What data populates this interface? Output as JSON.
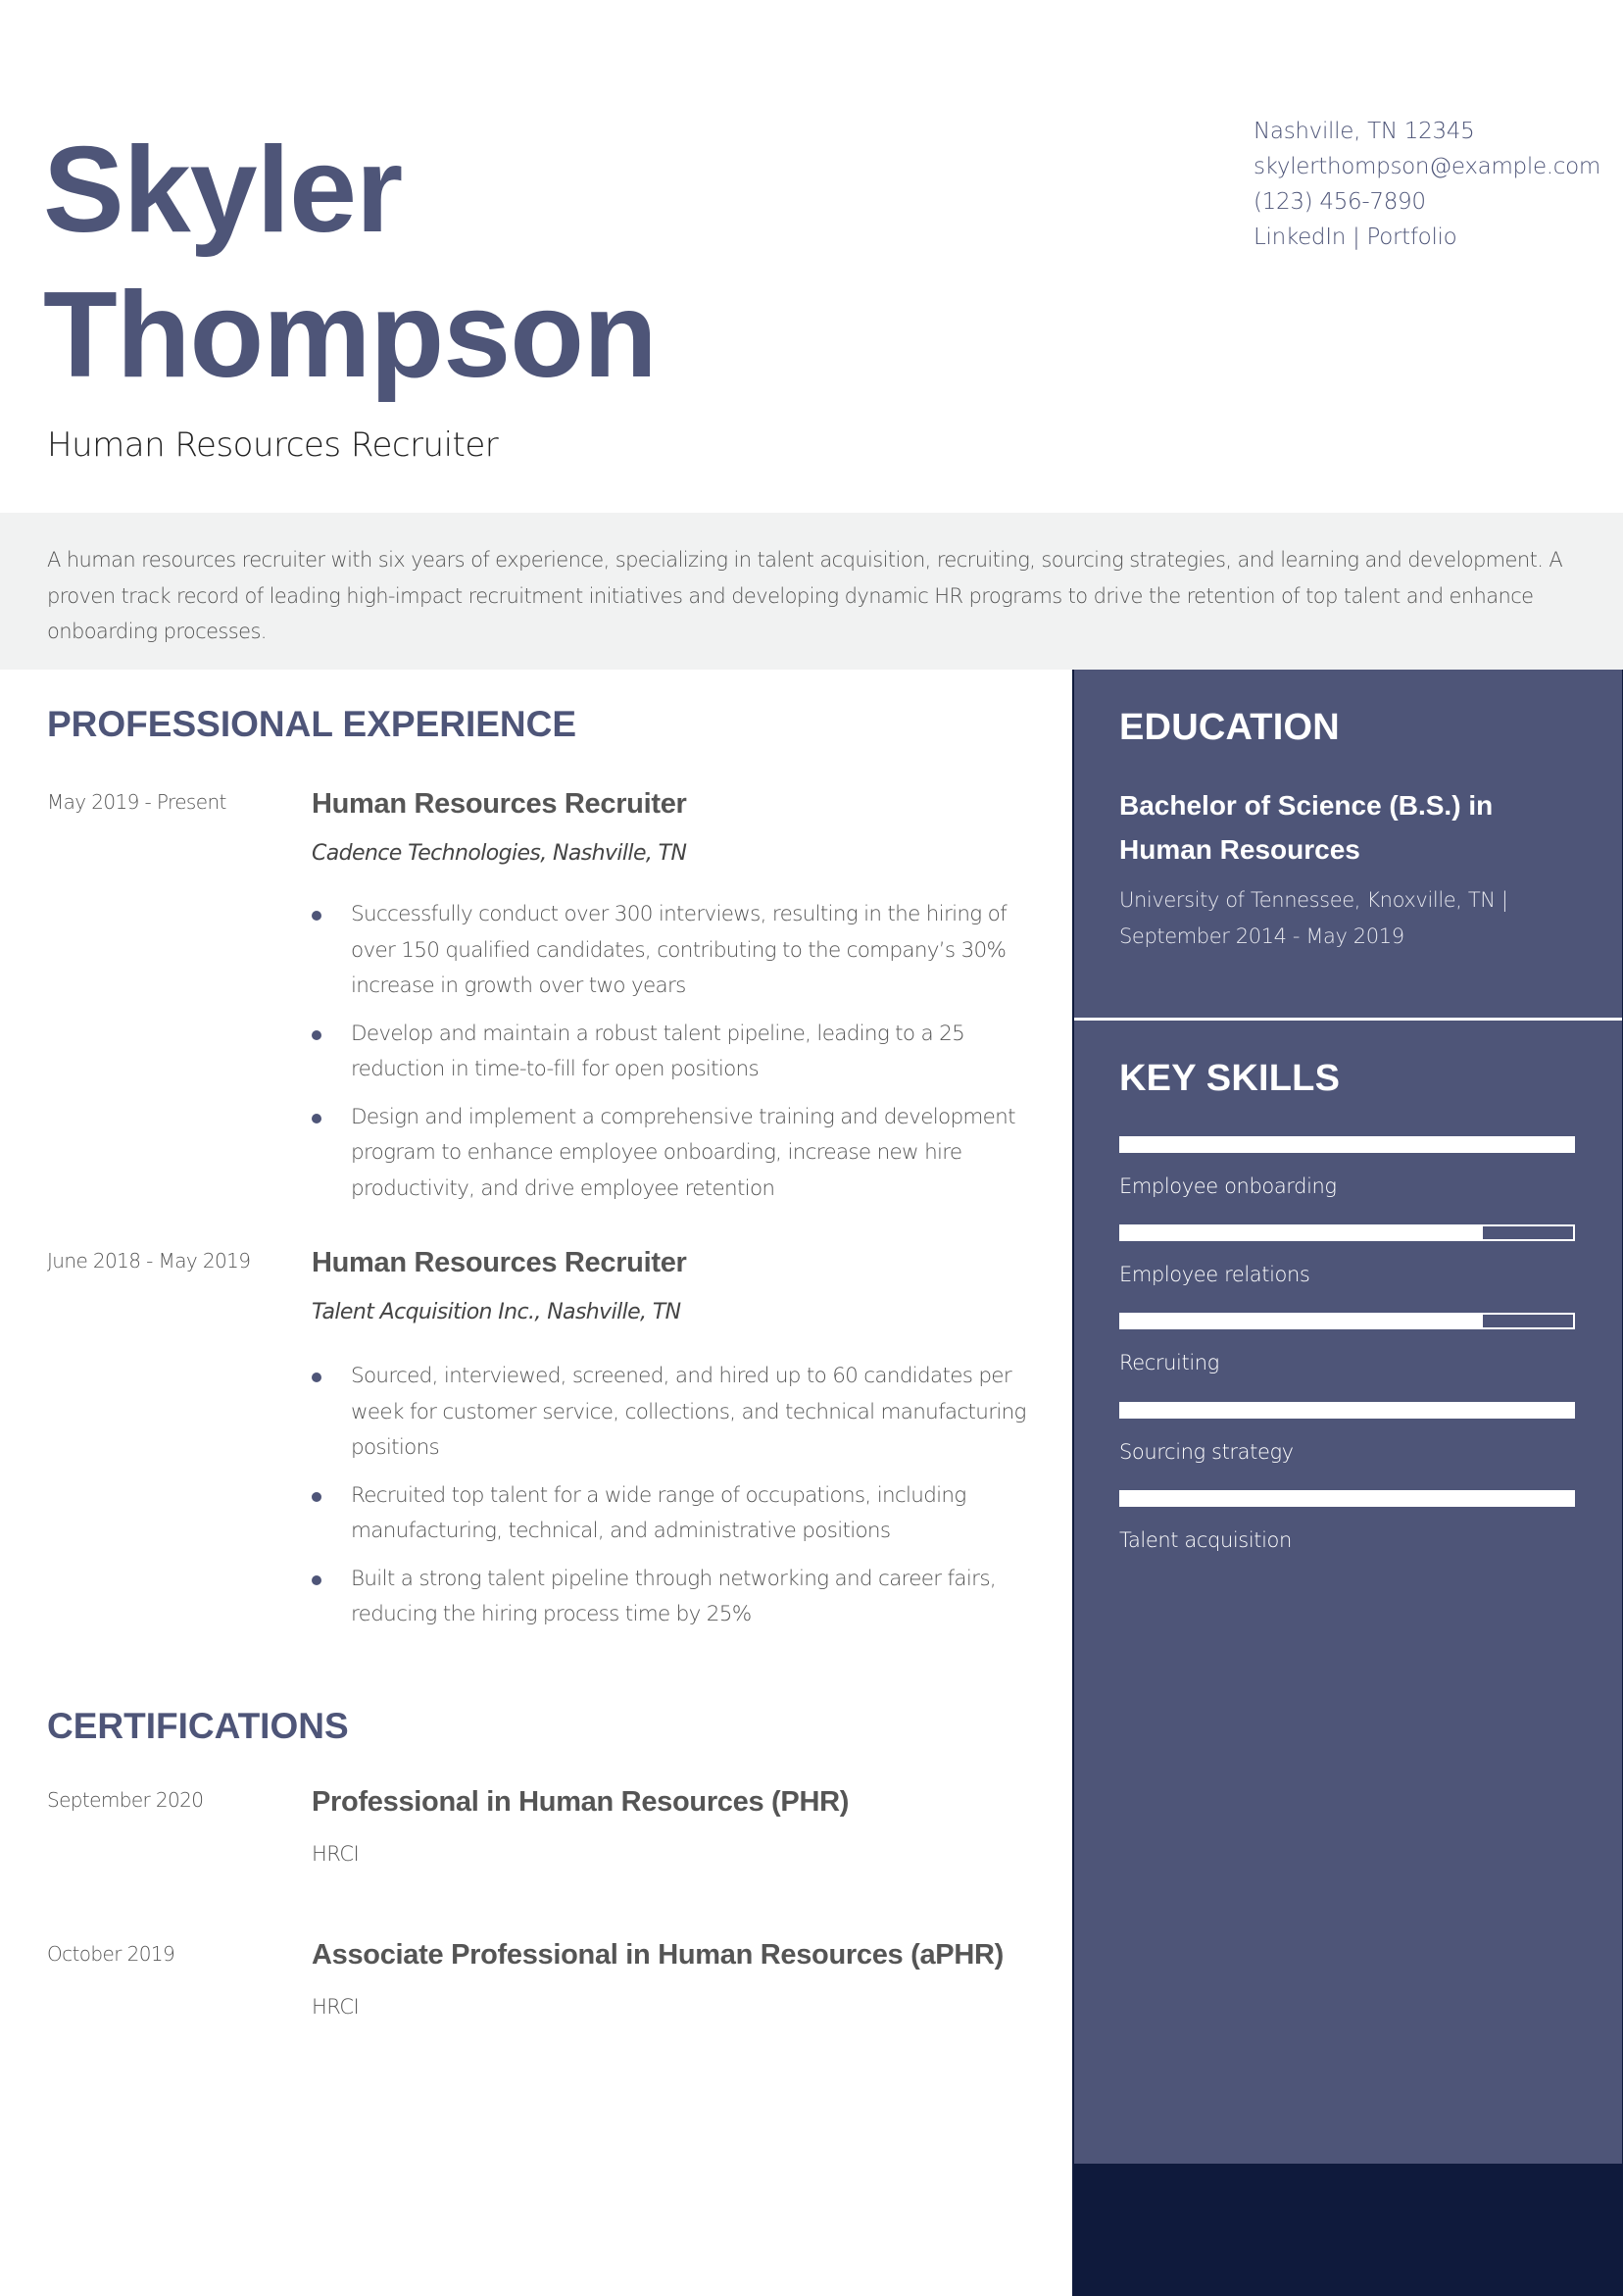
{
  "header": {
    "first_name": "Skyler",
    "last_name": "Thompson",
    "title": "Human Resources Recruiter"
  },
  "contact": {
    "location": "Nashville, TN 12345",
    "email": "skylerthompson@example.com",
    "phone": "(123) 456-7890",
    "linkedin": "LinkedIn",
    "separator": " | ",
    "portfolio": "Portfolio"
  },
  "summary": "A human resources recruiter with six years of experience, specializing in talent acquisition, recruiting, sourcing strategies, and learning and development. A proven track record of leading high-impact recruitment initiatives and developing dynamic HR programs to drive the retention of top talent and enhance onboarding processes.",
  "experience": {
    "heading": "PROFESSIONAL EXPERIENCE",
    "jobs": [
      {
        "dates": "May 2019 - Present",
        "title": "Human Resources Recruiter",
        "company": "Cadence Technologies, Nashville, TN",
        "bullets": [
          "Successfully conduct over 300 interviews, resulting in the hiring of over 150 qualified candidates, contributing to the company’s 30% increase in growth over two years",
          "Develop and maintain a robust talent pipeline, leading to a 25 reduction in time-to-fill for open positions",
          "Design and implement a comprehensive training and development program to enhance employee onboarding, increase new hire productivity, and drive employee retention"
        ]
      },
      {
        "dates": "June 2018 - May 2019",
        "title": "Human Resources Recruiter",
        "company": "Talent Acquisition Inc., Nashville, TN",
        "bullets": [
          "Sourced, interviewed, screened, and hired up to 60 candidates per week for customer service, collections, and technical manufacturing positions",
          "Recruited top talent for a wide range of occupations, including manufacturing, technical, and administrative positions",
          "Built a strong talent pipeline through networking and career fairs, reducing the hiring process time by 25%"
        ]
      }
    ]
  },
  "certifications": {
    "heading": "CERTIFICATIONS",
    "items": [
      {
        "date": "September 2020",
        "name": "Professional in Human Resources (PHR)",
        "issuer": "HRCI"
      },
      {
        "date": "October 2019",
        "name": "Associate Professional in Human Resources (aPHR)",
        "issuer": "HRCI"
      }
    ]
  },
  "education": {
    "heading": "EDUCATION",
    "degree": "Bachelor of Science (B.S.) in Human Resources",
    "school": "University of Tennessee, Knoxville, TN |",
    "dates": "September 2014 - May 2019"
  },
  "skills": {
    "heading": "KEY SKILLS",
    "items": [
      {
        "label": "Employee onboarding",
        "level": 1.0
      },
      {
        "label": "Employee relations",
        "level": 0.8
      },
      {
        "label": "Recruiting",
        "level": 0.8
      },
      {
        "label": "Sourcing strategy",
        "level": 1.0
      },
      {
        "label": "Talent acquisition",
        "level": 1.0
      }
    ]
  },
  "colors": {
    "accent": "#4e5578",
    "sidebar_dark": "#0f1a3c",
    "summary_bg": "#f1f2f2",
    "body_text": "#555555"
  }
}
